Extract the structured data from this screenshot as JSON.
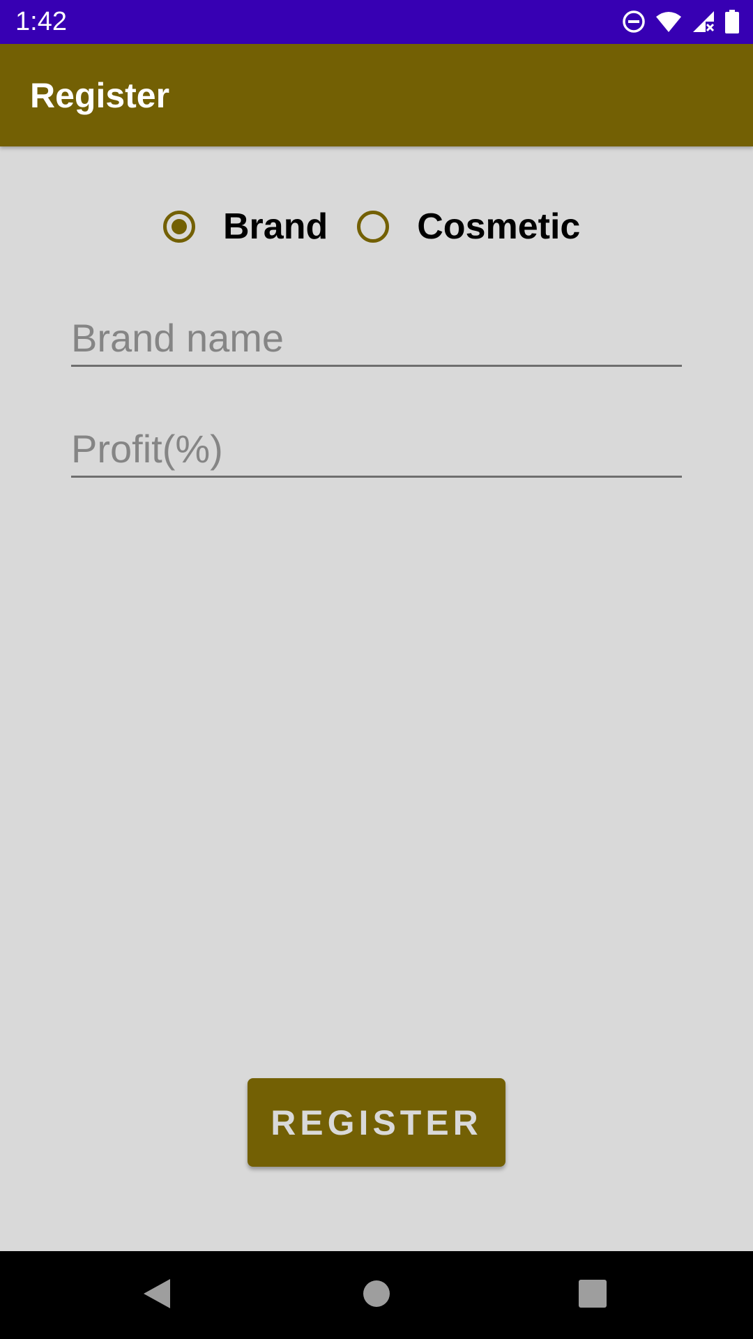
{
  "status_bar": {
    "time": "1:42",
    "icons": [
      "do-not-disturb-icon",
      "wifi-icon",
      "signal-icon",
      "battery-icon"
    ],
    "background": "#3700b3"
  },
  "app_bar": {
    "title": "Register",
    "background": "#736004"
  },
  "radio_group": {
    "options": [
      {
        "label": "Brand",
        "checked": true
      },
      {
        "label": "Cosmetic",
        "checked": false
      }
    ],
    "accent": "#736004"
  },
  "form": {
    "brand_name": {
      "value": "",
      "placeholder": "Brand name"
    },
    "profit": {
      "value": "",
      "placeholder": "Profit(%)"
    }
  },
  "register_button": {
    "label": "REGISTER"
  },
  "nav_bar": {
    "buttons": [
      "back-icon",
      "home-icon",
      "recents-icon"
    ]
  },
  "colors": {
    "background": "#d9d9d9",
    "primary": "#736004",
    "status": "#3700b3"
  }
}
